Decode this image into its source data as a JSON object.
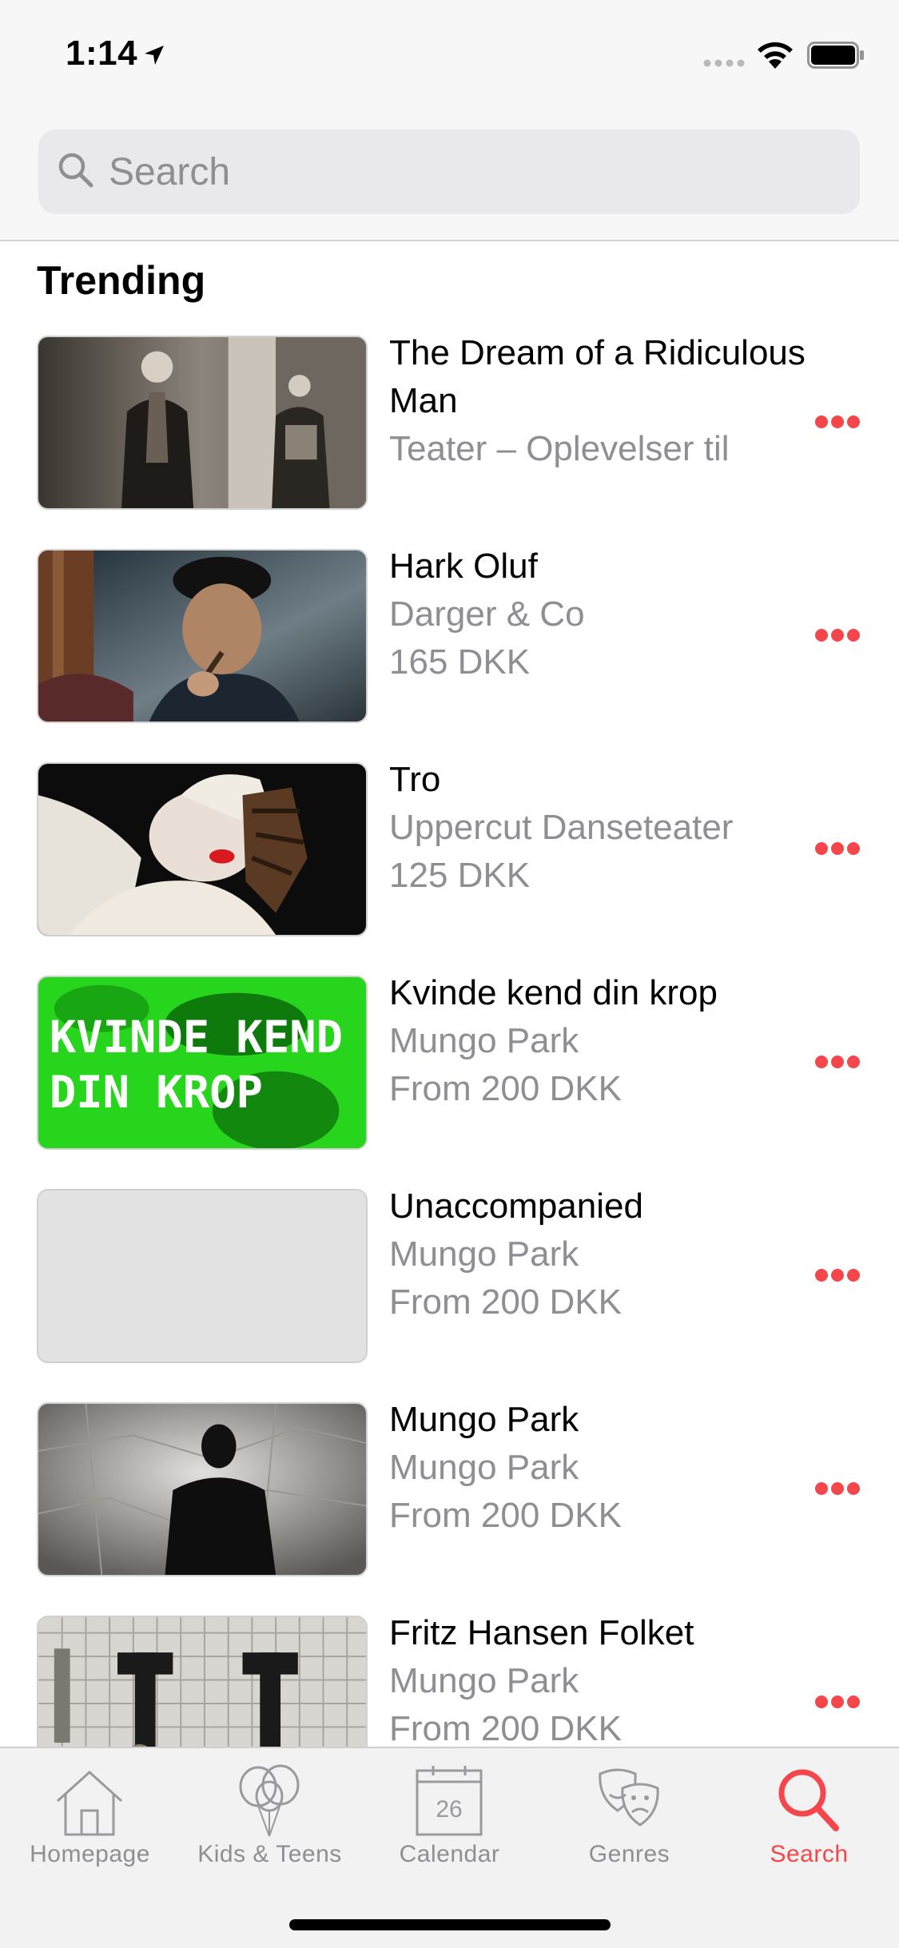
{
  "status_bar": {
    "time": "1:14"
  },
  "search": {
    "placeholder": "Search"
  },
  "section": {
    "title": "Trending"
  },
  "items": [
    {
      "title": "The Dream of a Ridiculous Man",
      "subtitle": "Teater – Oplevelser til",
      "price": ""
    },
    {
      "title": "Hark Oluf",
      "subtitle": "Darger & Co",
      "price": "165 DKK"
    },
    {
      "title": "Tro",
      "subtitle": "Uppercut Danseteater",
      "price": "125 DKK"
    },
    {
      "title": "Kvinde kend din krop",
      "subtitle": "Mungo Park",
      "price": "From 200 DKK"
    },
    {
      "title": "Unaccompanied",
      "subtitle": "Mungo Park",
      "price": "From 200 DKK"
    },
    {
      "title": "Mungo Park",
      "subtitle": "Mungo Park",
      "price": "From 200 DKK"
    },
    {
      "title": "Fritz Hansen Folket",
      "subtitle": "Mungo Park",
      "price": "From 200 DKK"
    }
  ],
  "thumb_text": {
    "kvinde_line1": "KVINDE KEND",
    "kvinde_line2": "DIN KROP"
  },
  "tabs": [
    {
      "label": "Homepage",
      "icon": "house-icon"
    },
    {
      "label": "Kids & Teens",
      "icon": "balloons-icon"
    },
    {
      "label": "Calendar",
      "icon": "calendar-icon",
      "day": "26"
    },
    {
      "label": "Genres",
      "icon": "theater-masks-icon"
    },
    {
      "label": "Search",
      "icon": "search-icon",
      "active": true
    }
  ],
  "colors": {
    "accent": "#f5474b",
    "secondary_text": "#8e8e93",
    "bar_background": "#f7f7f7"
  }
}
